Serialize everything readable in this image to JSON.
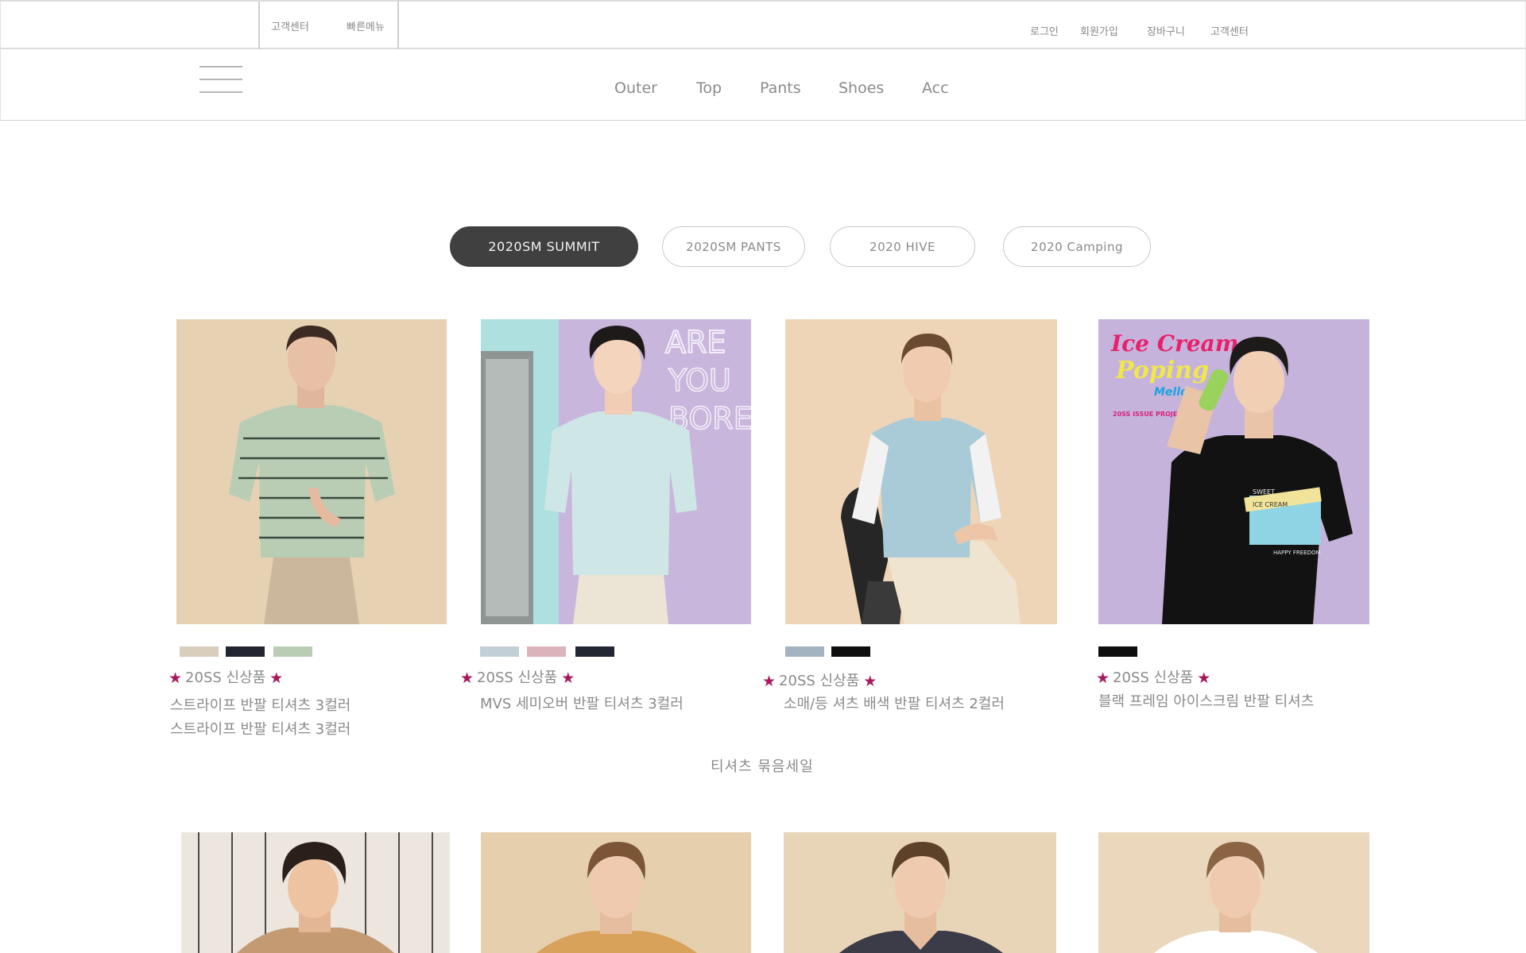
{
  "topbar": {
    "quick_menu": {
      "customer_center": "고객센터",
      "quick_menu": "빠른메뉴"
    },
    "links": [
      "로그인",
      "회원가입",
      "장바구니",
      "고객센터"
    ]
  },
  "nav": {
    "menu_icon": "hamburger-menu-icon",
    "items": [
      "Outer",
      "Top",
      "Pants",
      "Shoes",
      "Acc"
    ]
  },
  "tabs": [
    {
      "label": "2020SM SUMMIT",
      "active": true
    },
    {
      "label": "2020SM  PANTS",
      "active": false
    },
    {
      "label": "2020 HIVE",
      "active": false
    },
    {
      "label": "2020  Camping",
      "active": false
    }
  ],
  "products": [
    {
      "badge": "20SS 신상품",
      "names": [
        "스트라이프 반팔 티셔츠 3컬러",
        "스트라이프 반팔 티셔츠 3컬러"
      ],
      "colors": [
        "#d9cdbb",
        "#232631",
        "#b9cdb5"
      ],
      "photo_bg": "#e6d2b3"
    },
    {
      "badge": "20SS 신상품",
      "names": [
        "MVS 세미오버 반팔 티셔츠 3컬러"
      ],
      "colors": [
        "#c3cfd6",
        "#dbb4bb",
        "#232734"
      ],
      "photo_bg": "#c9b6dc",
      "neon_text": [
        "ARE",
        "YOU",
        "BORE"
      ]
    },
    {
      "badge": "20SS 신상품",
      "names": [
        "소매/등 셔츠 배색 반팔 티셔츠 2컬러"
      ],
      "colors": [
        "#a3b4c0",
        "#0e0e0e"
      ],
      "photo_bg": "#efd5b8"
    },
    {
      "badge": "20SS 신상품",
      "names": [
        "블랙 프레임 아이스크림 반팔 티셔츠"
      ],
      "colors": [
        "#0e0e0e"
      ],
      "photo_bg": "#c6b3dc",
      "poster": {
        "line1": "Ice Cream",
        "line2": "Poping",
        "line3": "Mellow",
        "line4": "20SS ISSUE PROJECT"
      },
      "tee_print": {
        "top": "SWEET",
        "mid": "ICE CREAM",
        "bottom": "HAPPY FREEDOM"
      }
    }
  ],
  "bundle_sale": "티셔츠  묶음세일",
  "row2": [
    {
      "photo_bg": "#ece6df",
      "shirt": "#c49a72"
    },
    {
      "photo_bg": "#e6cfac",
      "shirt": "#d8a25a"
    },
    {
      "photo_bg": "#e8d4b6",
      "shirt": "#3b3c48"
    },
    {
      "photo_bg": "#ebd7bb",
      "shirt": "#ffffff"
    }
  ],
  "colors": {
    "active_tab": "#404040",
    "star": "#a8185e",
    "text": "#8a8a8a"
  }
}
